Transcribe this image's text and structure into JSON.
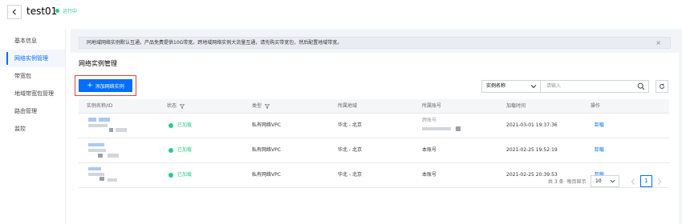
{
  "header": {
    "title": "test01",
    "status": "运行中",
    "status_color": "#29cc85"
  },
  "sidenav": {
    "items": [
      {
        "label": "基本信息"
      },
      {
        "label": "网络实例管理"
      },
      {
        "label": "带宽包"
      },
      {
        "label": "地域带宽包管理"
      },
      {
        "label": "路由管理"
      },
      {
        "label": "监控"
      }
    ],
    "active_index": 1
  },
  "notice": {
    "text": "同地域网络实例默认互通，产品免费提供10G带宽。跨地域网络实例大流量互通，请先购买带宽包，然后配置地域带宽。",
    "close": "×"
  },
  "main": {
    "title": "网络实例管理",
    "add_button": "添加网络实例",
    "search": {
      "select_value": "实例名称",
      "placeholder": "请输入"
    },
    "table": {
      "columns": [
        "实例名称/ID",
        "状态",
        "类型",
        "所属地域",
        "所属账号",
        "加载时间",
        "操作"
      ],
      "rows": [
        {
          "status": "已加载",
          "type": "私有网络VPC",
          "region": "华北 - 北京",
          "account": "跨账号",
          "time": "2021-03-01 19:37:36",
          "op": "卸载"
        },
        {
          "status": "已加载",
          "type": "私有网络VPC",
          "region": "华北 - 北京",
          "account": "本账号",
          "time": "2021-02-25 19:52:19",
          "op": "卸载"
        },
        {
          "status": "已加载",
          "type": "私有网络VPC",
          "region": "华北 - 北京",
          "account": "本账号",
          "time": "2021-02-25 20:39:53",
          "op": "卸载"
        }
      ]
    },
    "pagination": {
      "total": "共 3 条",
      "per_page_label": "每页显示",
      "per_page_value": "10",
      "current_page": "1"
    }
  },
  "colors": {
    "accent": "#006eff",
    "highlight_border": "#e0463d"
  }
}
